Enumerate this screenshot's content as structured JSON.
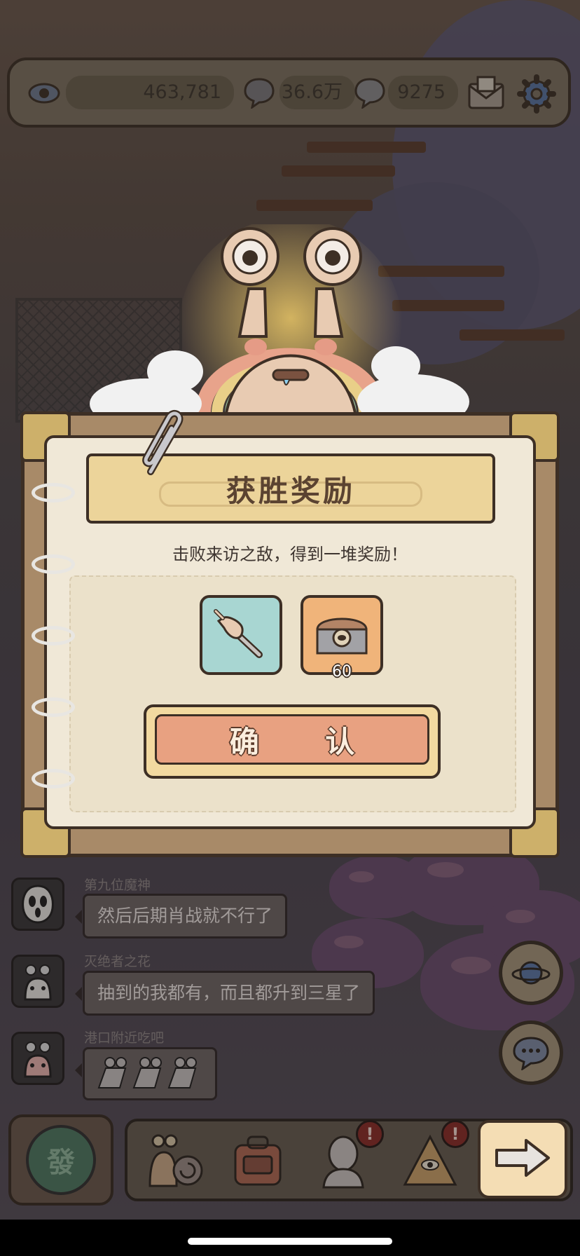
{
  "topbar": {
    "views_icon": "eye-icon",
    "views": "463,781",
    "chat_icon_1": "speech-bubble-icon",
    "messages": "36.6万",
    "chat_icon_2": "speech-bubble-icon",
    "comments": "9275",
    "mail_icon": "mail-icon",
    "settings_icon": "gear-icon"
  },
  "dialog": {
    "title": "获胜奖励",
    "subtitle": "击败来访之敌，得到一堆奖励！",
    "rewards": [
      {
        "icon": "pointing-hand-wand-icon",
        "count": ""
      },
      {
        "icon": "treasure-chest-icon",
        "count": "60"
      }
    ],
    "confirm_label": "确 认"
  },
  "chat": [
    {
      "name": "第九位魔神",
      "message": "然后后期肖战就不行了",
      "avatar_icon": "ghost-mask-icon"
    },
    {
      "name": "灭绝者之花",
      "message": "抽到的我都有，而且都升到三星了",
      "avatar_icon": "snail-avatar-icon"
    },
    {
      "name": "港口附近吃吧",
      "message": "",
      "avatar_icon": "snail-avatar-icon",
      "sticker": "running-snails-sticker"
    }
  ],
  "bottom_nav": {
    "send_label": "發",
    "badge_1": "!",
    "badge_2": "!"
  },
  "colors": {
    "banner": "#ecd49a",
    "confirm_face": "#e8a181",
    "reward_1_bg": "#a8d6d2",
    "reward_2_bg": "#f0b47a"
  }
}
